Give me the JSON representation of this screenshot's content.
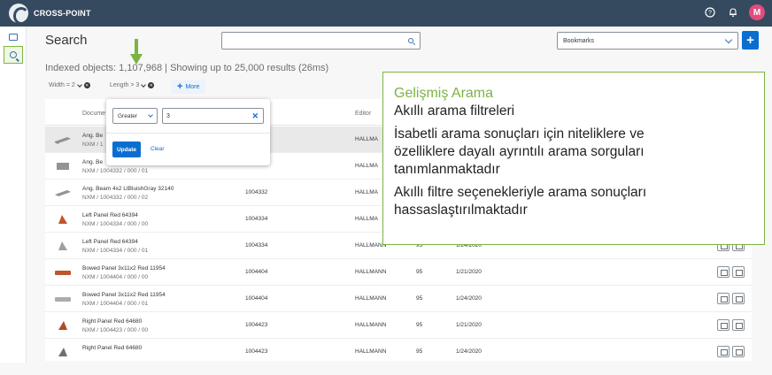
{
  "shell": {
    "brand": "CROSS-POINT",
    "avatar_initial": "M"
  },
  "header": {
    "search_title": "Search",
    "search_value": "",
    "bookmarks_placeholder": "Bookmarks",
    "add_label": "+"
  },
  "results": {
    "indexed_text": "Indexed objects: 1,107,968 | Showing up to 25,000 results (26ms)"
  },
  "filters": {
    "chips": [
      {
        "label": "Width = 2"
      },
      {
        "label": "Length > 3"
      }
    ],
    "more_label": "More"
  },
  "table": {
    "columns": {
      "document": "Docume",
      "editor": "Editor"
    },
    "rows": [
      {
        "name": "Ang. Be",
        "sub": "NXM / 1",
        "number": "",
        "editor": "HALLMA",
        "rev": "",
        "date": ""
      },
      {
        "name": "Ang. Be",
        "sub": "NXM / 1004332 / 000 / 01",
        "number": "",
        "editor": "HALLMA",
        "rev": "",
        "date": ""
      },
      {
        "name": "Ang. Beam 4x2 LtBluishGray 32140",
        "sub": "NXM / 1004332 / 000 / 02",
        "number": "1004332",
        "editor": "HALLMA",
        "rev": "",
        "date": ""
      },
      {
        "name": "Left Panel Red 64394",
        "sub": "NXM / 1004334 / 000 / 00",
        "number": "1004334",
        "editor": "HALLMA",
        "rev": "",
        "date": ""
      },
      {
        "name": "Left Panel Red 64394",
        "sub": "NXM / 1004334 / 000 / 01",
        "number": "1004334",
        "editor": "HALLMANN",
        "rev": "95",
        "date": "1/24/2020"
      },
      {
        "name": "Bowed Panel 3x11x2 Red 11954",
        "sub": "NXM / 1004404 / 000 / 00",
        "number": "1004404",
        "editor": "HALLMANN",
        "rev": "95",
        "date": "1/21/2020"
      },
      {
        "name": "Bowed Panel 3x11x2 Red 11954",
        "sub": "NXM / 1004404 / 000 / 01",
        "number": "1004404",
        "editor": "HALLMANN",
        "rev": "95",
        "date": "1/24/2020"
      },
      {
        "name": "Right Panel Red 64680",
        "sub": "NXM / 1004423 / 000 / 00",
        "number": "1004423",
        "editor": "HALLMANN",
        "rev": "95",
        "date": "1/21/2020"
      },
      {
        "name": "Right Panel Red 64680",
        "sub": "",
        "number": "1004423",
        "editor": "HALLMANN",
        "rev": "95",
        "date": "1/24/2020"
      }
    ]
  },
  "popover": {
    "operator": "Greater",
    "value": "3",
    "update_label": "Update",
    "clear_label": "Clear"
  },
  "callout": {
    "title": "Gelişmiş Arama",
    "line1": "Akıllı arama filtreleri",
    "line2": "İsabetli arama sonuçları için niteliklere ve",
    "line3": "özelliklere dayalı ayrıntılı arama sorguları",
    "line4": "tanımlanmaktadır",
    "line5": "Akıllı filtre seçenekleriyle arama sonuçları",
    "line6": "hassaslaştırılmaktadır"
  },
  "colors": {
    "shell": "#354a5f",
    "accent": "#0a6ed1",
    "callout_border": "#7cb342",
    "avatar": "#e34b7c"
  }
}
